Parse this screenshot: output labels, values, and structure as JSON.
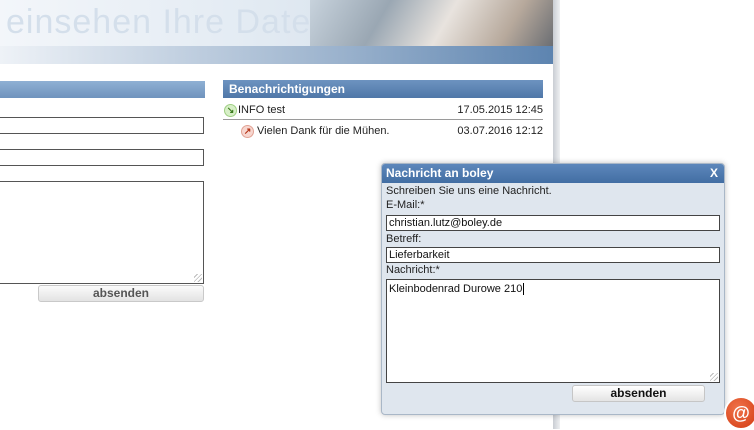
{
  "header": {
    "banner_text": "einsehen Ihre Daten"
  },
  "left_form": {
    "send_label": "absenden"
  },
  "notifications": {
    "title": "Benachrichtigungen",
    "items": [
      {
        "icon": "arrow-down-right-icon",
        "title": "INFO test",
        "date": "17.05.2015 12:45"
      },
      {
        "icon": "arrow-up-right-icon",
        "title": "Vielen Dank für die Mühen.",
        "date": "03.07.2016 12:12"
      }
    ]
  },
  "dialog": {
    "title": "Nachricht an boley",
    "close_label": "X",
    "intro": "Schreiben Sie uns eine Nachricht.",
    "email_label": "E-Mail:*",
    "email_value": "christian.lutz@boley.de",
    "subject_label": "Betreff:",
    "subject_value": "Lieferbarkeit",
    "message_label": "Nachricht:*",
    "message_value": "Kleinbodenrad Durowe 210",
    "send_label": "absenden"
  },
  "badge": {
    "label": "@"
  },
  "colors": {
    "accent": "#4f77a8",
    "badge": "#d23b12"
  }
}
